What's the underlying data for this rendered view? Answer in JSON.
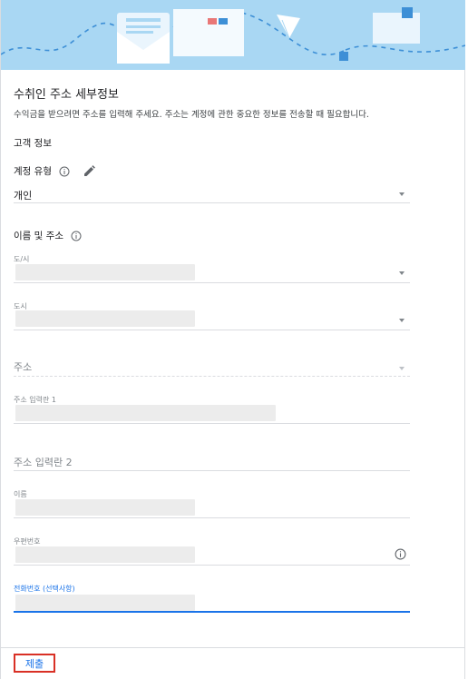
{
  "form": {
    "title": "수취인 주소 세부정보",
    "description": "수익금을 받으려면 주소를 입력해 주세요. 주소는 계정에 관한 중요한 정보를 전송할 때 필요합니다.",
    "section_title": "고객 정보",
    "account_type": {
      "label": "계정 유형",
      "value": "개인"
    },
    "name_address": {
      "label": "이름 및 주소"
    },
    "fields": {
      "state": "도/시",
      "city": "도시",
      "address": "주소",
      "address_line1": "주소 입력란 1",
      "address_line2": "주소 입력란 2",
      "name": "이름",
      "postal_code": "우편번호",
      "phone": "전화번호 (선택사항)"
    },
    "submit_label": "제출"
  },
  "colors": {
    "banner": "#a9d7f3",
    "accent": "#1a73e8",
    "highlight_border": "#d93025"
  },
  "icons": [
    "info-icon",
    "pencil-icon",
    "dropdown-arrow-icon",
    "envelope-icon",
    "paper-plane-icon",
    "mailbox-icon"
  ]
}
